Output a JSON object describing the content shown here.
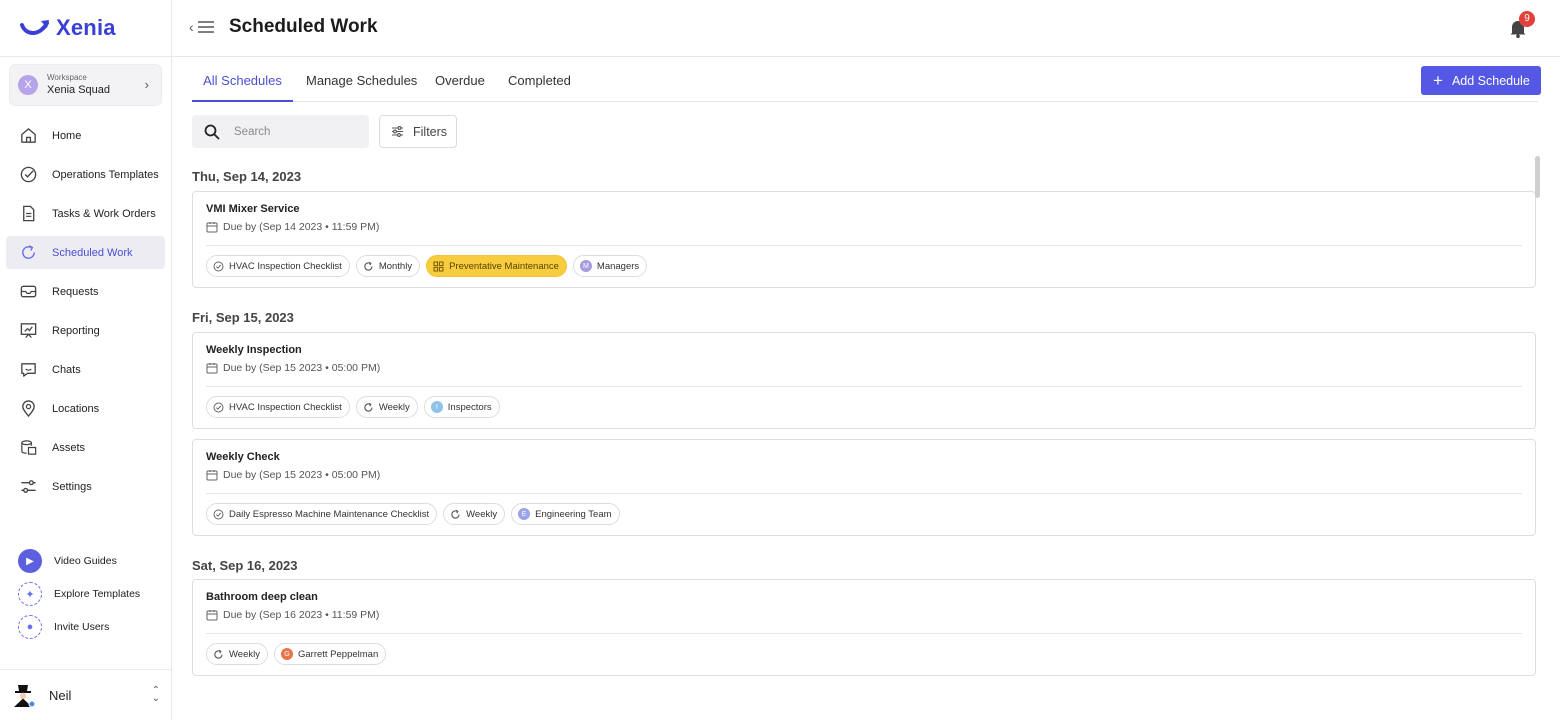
{
  "brand": {
    "name": "Xenia",
    "color": "#3a3fd6"
  },
  "workspace": {
    "label": "Workspace",
    "name": "Xenia Squad",
    "initial": "X"
  },
  "sidebar": {
    "items": [
      {
        "label": "Home",
        "icon": "home-icon"
      },
      {
        "label": "Operations Templates",
        "icon": "check-circle-icon"
      },
      {
        "label": "Tasks & Work Orders",
        "icon": "document-icon"
      },
      {
        "label": "Scheduled Work",
        "icon": "recurring-icon",
        "active": true
      },
      {
        "label": "Requests",
        "icon": "inbox-icon"
      },
      {
        "label": "Reporting",
        "icon": "chart-board-icon"
      },
      {
        "label": "Chats",
        "icon": "chat-icon"
      },
      {
        "label": "Locations",
        "icon": "location-pin-icon"
      },
      {
        "label": "Assets",
        "icon": "assets-icon"
      },
      {
        "label": "Settings",
        "icon": "sliders-icon"
      }
    ],
    "bottom": [
      {
        "label": "Video Guides",
        "icon": "play-icon"
      },
      {
        "label": "Explore Templates",
        "icon": "explore-icon"
      },
      {
        "label": "Invite Users",
        "icon": "invite-user-icon"
      }
    ],
    "user": {
      "name": "Neil"
    }
  },
  "header": {
    "title": "Scheduled Work",
    "notifications": "9"
  },
  "tabs": [
    {
      "label": "All Schedules",
      "active": true
    },
    {
      "label": "Manage Schedules"
    },
    {
      "label": "Overdue"
    },
    {
      "label": "Completed"
    }
  ],
  "actions": {
    "add_schedule": "Add Schedule"
  },
  "search": {
    "placeholder": "Search"
  },
  "filters": {
    "label": "Filters"
  },
  "groups": [
    {
      "date": "Thu, Sep 14, 2023",
      "cards": [
        {
          "title": "VMI Mixer Service",
          "due": "Due by (Sep 14 2023 • 11:59 PM)",
          "chips": [
            {
              "type": "checklist",
              "label": "HVAC Inspection Checklist"
            },
            {
              "type": "recurrence",
              "label": "Monthly"
            },
            {
              "type": "category",
              "label": "Preventative Maintenance"
            },
            {
              "type": "assignee",
              "label": "Managers",
              "initial": "M",
              "color": "#a99be0"
            }
          ]
        }
      ]
    },
    {
      "date": "Fri, Sep 15, 2023",
      "cards": [
        {
          "title": "Weekly Inspection",
          "due": "Due by (Sep 15 2023 • 05:00 PM)",
          "chips": [
            {
              "type": "checklist",
              "label": "HVAC Inspection Checklist"
            },
            {
              "type": "recurrence",
              "label": "Weekly"
            },
            {
              "type": "assignee",
              "label": "Inspectors",
              "initial": "I",
              "color": "#8fc2e8"
            }
          ]
        },
        {
          "title": "Weekly Check",
          "due": "Due by (Sep 15 2023 • 05:00 PM)",
          "chips": [
            {
              "type": "checklist",
              "label": "Daily Espresso Machine Maintenance Checklist"
            },
            {
              "type": "recurrence",
              "label": "Weekly"
            },
            {
              "type": "assignee",
              "label": "Engineering Team",
              "initial": "E",
              "color": "#9ba3e8"
            }
          ]
        }
      ]
    },
    {
      "date": "Sat, Sep 16, 2023",
      "cards": [
        {
          "title": "Bathroom deep clean",
          "due": "Due by (Sep 16 2023 • 11:59 PM)",
          "chips": [
            {
              "type": "recurrence",
              "label": "Weekly"
            },
            {
              "type": "assignee",
              "label": "Garrett Peppelman",
              "initial": "G",
              "color": "#e8744a"
            }
          ]
        }
      ]
    }
  ],
  "colors": {
    "accent": "#5458e4",
    "category_yellow": "#f7cc3e",
    "badge_red": "#e2403a"
  }
}
